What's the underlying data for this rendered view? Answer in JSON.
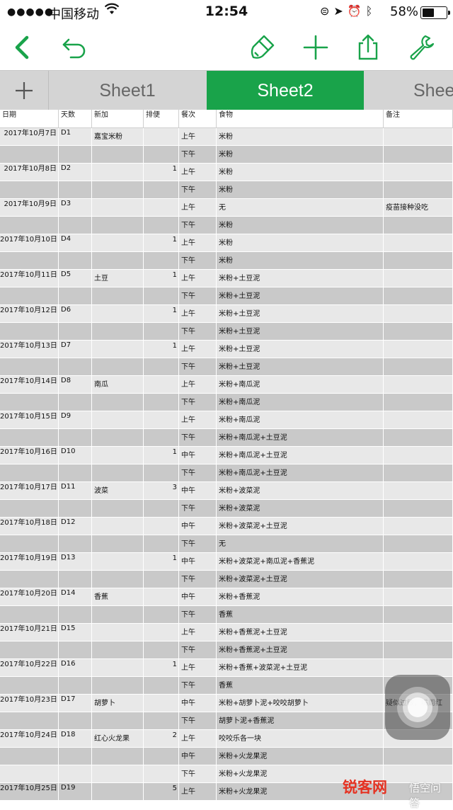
{
  "status_bar": {
    "signal": "●●●●●",
    "carrier": "中国移动",
    "time": "12:54",
    "battery_percent": "58%",
    "battery_level": 0.58,
    "icons": [
      "wifi-icon",
      "orientation-lock-icon",
      "location-icon",
      "alarm-icon",
      "bluetooth-icon",
      "battery-icon"
    ]
  },
  "toolbar": {
    "accent_color": "#19a34a",
    "buttons": [
      "back-icon",
      "undo-icon",
      "format-brush-icon",
      "add-icon",
      "share-icon",
      "settings-wrench-icon"
    ]
  },
  "tabs": {
    "add_label": "+",
    "items": [
      {
        "label": "Sheet1",
        "active": false
      },
      {
        "label": "Sheet2",
        "active": true
      },
      {
        "label": "Shee",
        "active": false
      }
    ]
  },
  "table": {
    "columns": [
      "日期",
      "天数",
      "新加",
      "排便",
      "餐次",
      "食物",
      "备注"
    ],
    "rows": [
      [
        "2017年10月7日",
        "D1",
        "嘉宝米粉",
        "",
        "上午",
        "米粉",
        ""
      ],
      [
        "",
        "",
        "",
        "",
        "下午",
        "米粉",
        ""
      ],
      [
        "2017年10月8日",
        "D2",
        "",
        "1",
        "上午",
        "米粉",
        ""
      ],
      [
        "",
        "",
        "",
        "",
        "下午",
        "米粉",
        ""
      ],
      [
        "2017年10月9日",
        "D3",
        "",
        "",
        "上午",
        "无",
        "疫苗接种没吃"
      ],
      [
        "",
        "",
        "",
        "",
        "下午",
        "米粉",
        ""
      ],
      [
        "2017年10月10日",
        "D4",
        "",
        "1",
        "上午",
        "米粉",
        ""
      ],
      [
        "",
        "",
        "",
        "",
        "下午",
        "米粉",
        ""
      ],
      [
        "2017年10月11日",
        "D5",
        "土豆",
        "1",
        "上午",
        "米粉+土豆泥",
        ""
      ],
      [
        "",
        "",
        "",
        "",
        "下午",
        "米粉+土豆泥",
        ""
      ],
      [
        "2017年10月12日",
        "D6",
        "",
        "1",
        "上午",
        "米粉+土豆泥",
        ""
      ],
      [
        "",
        "",
        "",
        "",
        "下午",
        "米粉+土豆泥",
        ""
      ],
      [
        "2017年10月13日",
        "D7",
        "",
        "1",
        "上午",
        "米粉+土豆泥",
        ""
      ],
      [
        "",
        "",
        "",
        "",
        "下午",
        "米粉+土豆泥",
        ""
      ],
      [
        "2017年10月14日",
        "D8",
        "南瓜",
        "",
        "上午",
        "米粉+南瓜泥",
        ""
      ],
      [
        "",
        "",
        "",
        "",
        "下午",
        "米粉+南瓜泥",
        ""
      ],
      [
        "2017年10月15日",
        "D9",
        "",
        "",
        "上午",
        "米粉+南瓜泥",
        ""
      ],
      [
        "",
        "",
        "",
        "",
        "下午",
        "米粉+南瓜泥+土豆泥",
        ""
      ],
      [
        "2017年10月16日",
        "D10",
        "",
        "1",
        "中午",
        "米粉+南瓜泥+土豆泥",
        ""
      ],
      [
        "",
        "",
        "",
        "",
        "下午",
        "米粉+南瓜泥+土豆泥",
        ""
      ],
      [
        "2017年10月17日",
        "D11",
        "波菜",
        "3",
        "中午",
        "米粉+波菜泥",
        ""
      ],
      [
        "",
        "",
        "",
        "",
        "下午",
        "米粉+波菜泥",
        ""
      ],
      [
        "2017年10月18日",
        "D12",
        "",
        "",
        "中午",
        "米粉+波菜泥+土豆泥",
        ""
      ],
      [
        "",
        "",
        "",
        "",
        "下午",
        "无",
        ""
      ],
      [
        "2017年10月19日",
        "D13",
        "",
        "1",
        "中午",
        "米粉+波菜泥+南瓜泥+香蕉泥",
        ""
      ],
      [
        "",
        "",
        "",
        "",
        "下午",
        "米粉+波菜泥+土豆泥",
        ""
      ],
      [
        "2017年10月20日",
        "D14",
        "香蕉",
        "",
        "中午",
        "米粉+香蕉泥",
        ""
      ],
      [
        "",
        "",
        "",
        "",
        "下午",
        "香蕉",
        ""
      ],
      [
        "2017年10月21日",
        "D15",
        "",
        "",
        "上午",
        "米粉+香蕉泥+土豆泥",
        ""
      ],
      [
        "",
        "",
        "",
        "",
        "下午",
        "米粉+香蕉泥+土豆泥",
        ""
      ],
      [
        "2017年10月22日",
        "D16",
        "",
        "1",
        "上午",
        "米粉+香蕉+波菜泥+土豆泥",
        ""
      ],
      [
        "",
        "",
        "",
        "",
        "下午",
        "香蕉",
        ""
      ],
      [
        "2017年10月23日",
        "D17",
        "胡萝卜",
        "",
        "中午",
        "米粉+胡萝卜泥+咬咬胡萝卜",
        "疑似过敏，嘴周红"
      ],
      [
        "",
        "",
        "",
        "",
        "下午",
        "胡萝卜泥+香蕉泥",
        ""
      ],
      [
        "2017年10月24日",
        "D18",
        "红心火龙果",
        "2",
        "上午",
        "咬咬乐各一块",
        ""
      ],
      [
        "",
        "",
        "",
        "",
        "中午",
        "米粉+火龙果泥",
        ""
      ],
      [
        "",
        "",
        "",
        "",
        "下午",
        "米粉+火龙果泥",
        ""
      ],
      [
        "2017年10月25日",
        "D19",
        "",
        "5",
        "上午",
        "米粉+火龙果泥",
        ""
      ]
    ]
  },
  "assistive_touch": {
    "icon": "assistive-touch-icon"
  },
  "watermark": {
    "logo": "锐客网",
    "sub": "悟空问答"
  }
}
